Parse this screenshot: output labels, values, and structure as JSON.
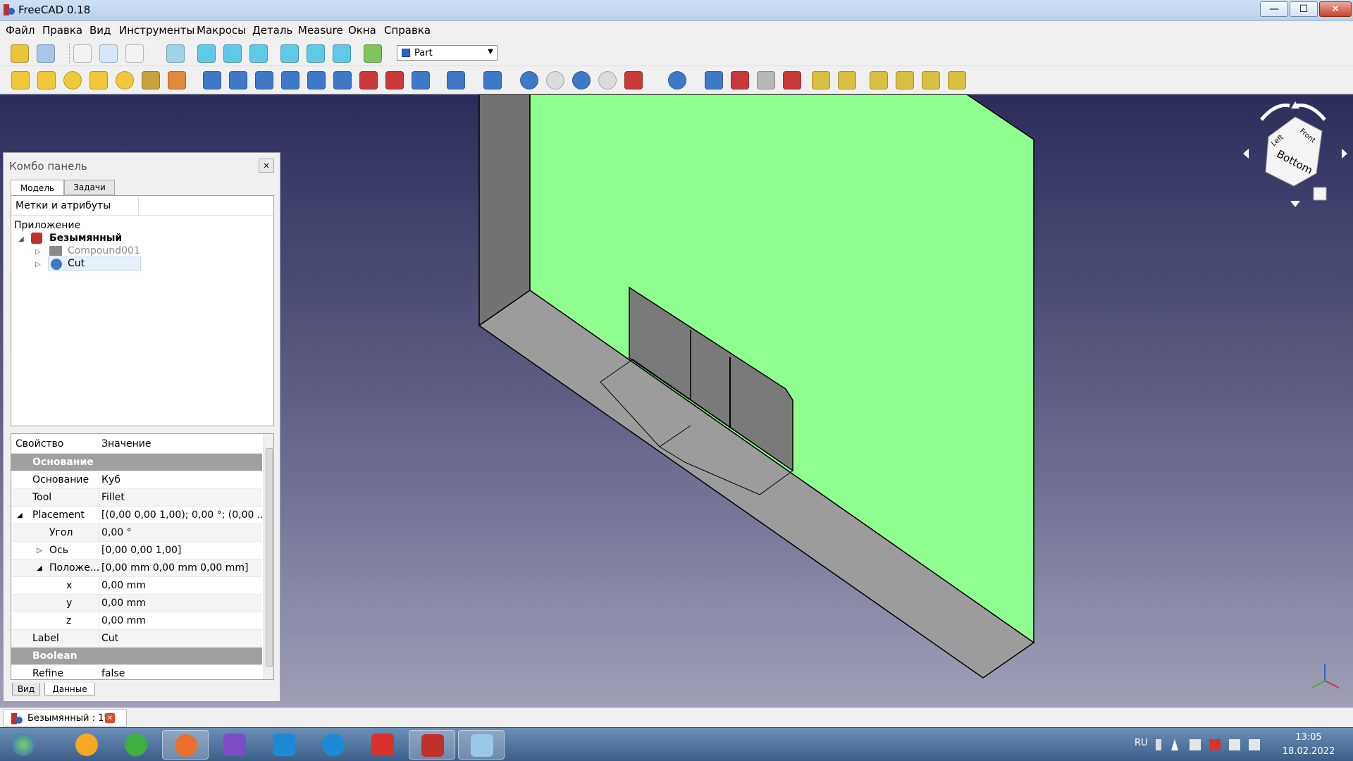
{
  "window": {
    "title": "FreeCAD 0.18",
    "min_label": "—",
    "max_label": "☐",
    "close_label": "✕"
  },
  "menu": [
    "Файл",
    "Правка",
    "Вид",
    "Инструменты",
    "Макросы",
    "Деталь",
    "Measure",
    "Окна",
    "Справка"
  ],
  "toolbar": {
    "workbench": "Part"
  },
  "combo": {
    "title": "Комбо панель",
    "close_label": "✕",
    "tabs": [
      "Модель",
      "Задачи"
    ],
    "tree_header": "Метки и атрибуты",
    "tree": {
      "root": "Приложение",
      "document": "Безымянный",
      "items": [
        {
          "label": "Compound001",
          "icon": "compound-icon",
          "hidden": true
        },
        {
          "label": "Cut",
          "icon": "cut-icon",
          "selected": true
        }
      ]
    },
    "props_headers": [
      "Свойство",
      "Значение"
    ],
    "props": [
      {
        "type": "group",
        "name": "Основание"
      },
      {
        "name": "Основание",
        "value": "Куб"
      },
      {
        "name": "Tool",
        "value": "Fillet"
      },
      {
        "name": "Placement",
        "value": "[(0,00 0,00 1,00); 0,00 °; (0,00 ...",
        "expanded": true,
        "indent": 0
      },
      {
        "name": "Угол",
        "value": "0,00 °",
        "indent": 1
      },
      {
        "name": "Ось",
        "value": "[0,00 0,00 1,00]",
        "indent": 1,
        "collapsed": true
      },
      {
        "name": "Положе...",
        "value": "[0,00 mm  0,00 mm  0,00 mm]",
        "indent": 1,
        "expanded": true
      },
      {
        "name": "x",
        "value": "0,00 mm",
        "indent": 2
      },
      {
        "name": "y",
        "value": "0,00 mm",
        "indent": 2
      },
      {
        "name": "z",
        "value": "0,00 mm",
        "indent": 2
      },
      {
        "name": "Label",
        "value": "Cut"
      },
      {
        "type": "group",
        "name": "Boolean"
      },
      {
        "name": "Refine",
        "value": "false"
      }
    ],
    "bottom_tabs": [
      "Вид",
      "Данные"
    ]
  },
  "navcube": {
    "faces": [
      "Bottom",
      "Front",
      "Left"
    ]
  },
  "doc_tab": {
    "label": "Безымянный : 1*",
    "close_label": "✕"
  },
  "taskbar": {
    "apps": [
      "start",
      "aimp",
      "utorrent",
      "firefox",
      "visual-studio",
      "ccleaner-c",
      "ccleaner",
      "adobe-reader",
      "freecad",
      "paint"
    ],
    "lang": "RU",
    "time": "13:05",
    "date": "18.02.2022"
  },
  "colors": {
    "face_green": "#8fff8f",
    "solid_gray": "#9a9a9a",
    "dark_gray": "#737373",
    "bg_top": "#2c2d5c",
    "bg_bottom": "#9fa0b6"
  }
}
